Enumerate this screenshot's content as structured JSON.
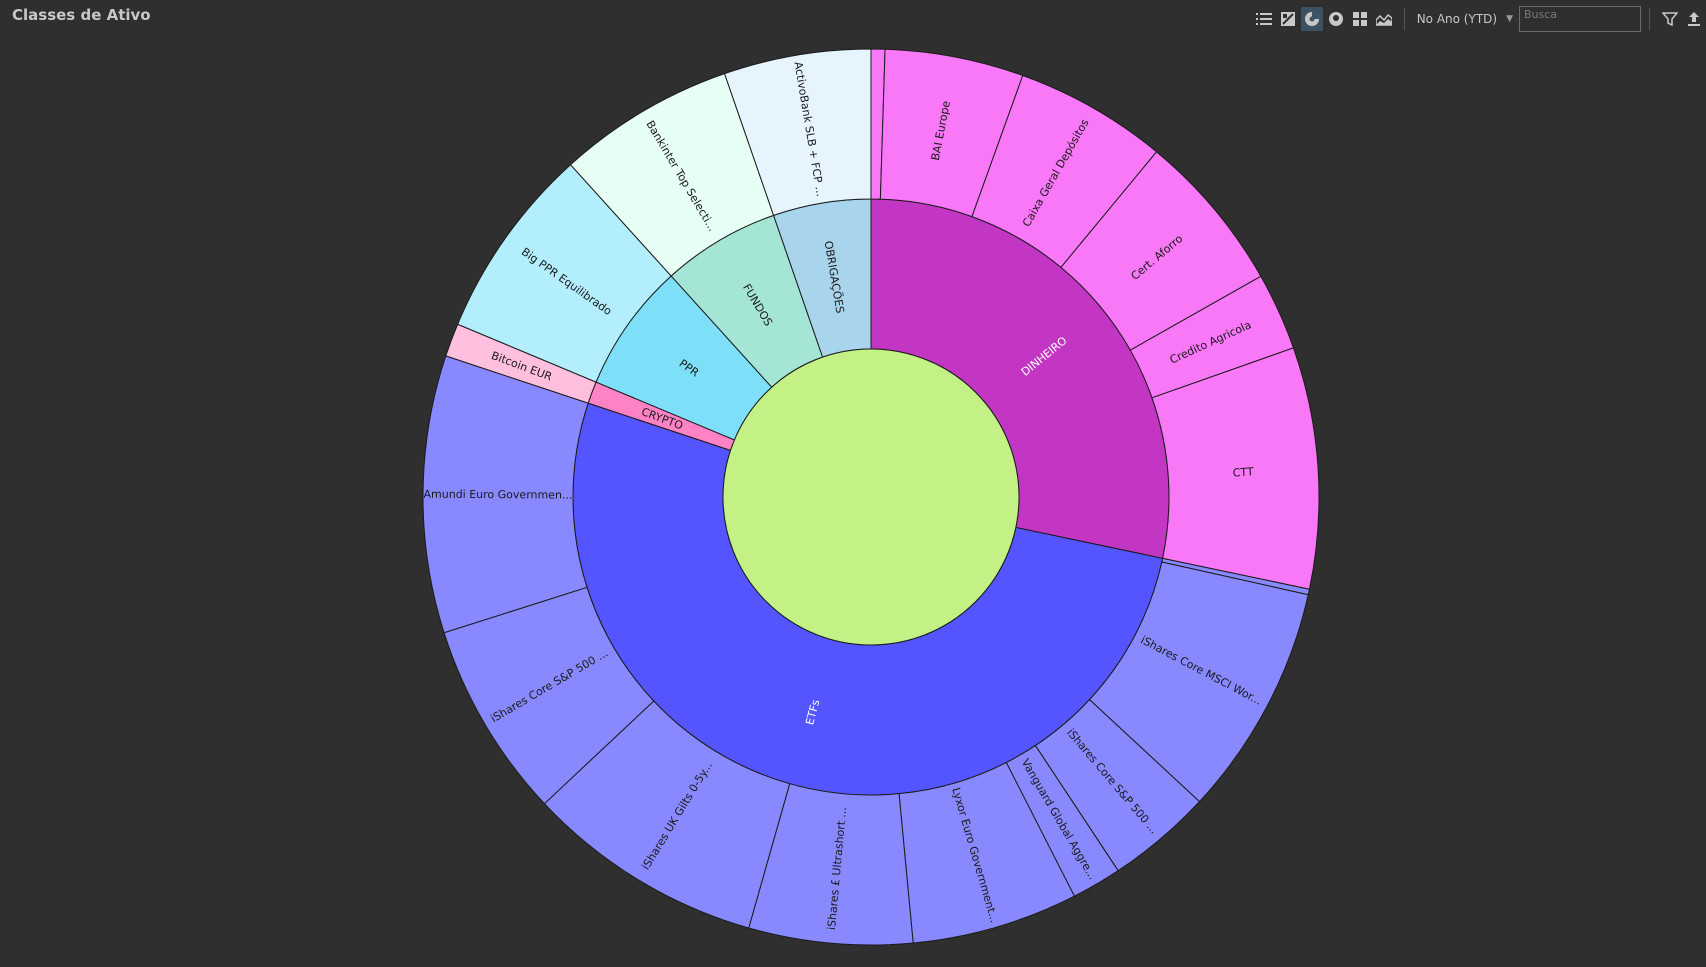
{
  "header": {
    "title": "Classes de Ativo"
  },
  "toolbar": {
    "icons": [
      "list-view-icon",
      "treemap-view-icon",
      "sunburst-view-icon",
      "donut-view-icon",
      "grid-view-icon",
      "area-chart-icon",
      "filter-icon",
      "export-icon"
    ],
    "period_label": "No Ano (YTD)",
    "search_placeholder": "Busca"
  },
  "chart_data": {
    "type": "sunburst",
    "title": "",
    "center_color": "#c3f185",
    "categories": [
      {
        "name": "DINHEIRO",
        "value": 28.3,
        "color": "#c335c3",
        "label_light": true,
        "children": [
          {
            "name": "",
            "value": 0.5,
            "color": "#f878f8"
          },
          {
            "name": "BAI Europe",
            "value": 5.0,
            "color": "#f878f8"
          },
          {
            "name": "Caixa Geral Depósitos",
            "value": 5.5,
            "color": "#f878f8"
          },
          {
            "name": "Cert. Aforro",
            "value": 5.8,
            "color": "#f878f8"
          },
          {
            "name": "Credito Agricola",
            "value": 2.8,
            "color": "#f878f8"
          },
          {
            "name": "CTT",
            "value": 8.7,
            "color": "#f878f8"
          }
        ]
      },
      {
        "name": "ETFs",
        "value": 51.8,
        "color": "#5555ff",
        "label_light": true,
        "children": [
          {
            "name": "",
            "value": 0.2,
            "color": "#8888ff"
          },
          {
            "name": "iShares Core MSCI Wor...",
            "value": 8.4,
            "color": "#8888ff"
          },
          {
            "name": "iShares Core S&P 500 ...",
            "value": 3.8,
            "color": "#8888ff"
          },
          {
            "name": "Vanguard Global Aggre...",
            "value": 1.8,
            "color": "#8888ff"
          },
          {
            "name": "Lyxor Euro Government...",
            "value": 6.0,
            "color": "#8888ff"
          },
          {
            "name": "iShares £ Ultrashort ...",
            "value": 5.9,
            "color": "#8888ff"
          },
          {
            "name": "iShares UK Gilts 0-5y...",
            "value": 8.6,
            "color": "#8888ff"
          },
          {
            "name": "iShares Core S&P 500 ...",
            "value": 7.1,
            "color": "#8888ff"
          },
          {
            "name": "Amundi Euro Governmen...",
            "value": 10.0,
            "color": "#8888ff"
          }
        ]
      },
      {
        "name": "CRYPTO",
        "value": 1.2,
        "color": "#ff82c4",
        "label_light": false,
        "children": [
          {
            "name": "Bitcoin EUR",
            "value": 1.2,
            "color": "#ffc0e0"
          }
        ]
      },
      {
        "name": "PPR",
        "value": 7.0,
        "color": "#7ddff8",
        "label_light": false,
        "children": [
          {
            "name": "Big PPR Equilibrado",
            "value": 7.0,
            "color": "#b3eefc"
          }
        ]
      },
      {
        "name": "FUNDOS",
        "value": 6.4,
        "color": "#a5e5d5",
        "label_light": false,
        "children": [
          {
            "name": "Bankinter Top Selecti...",
            "value": 6.4,
            "color": "#e6fef4"
          }
        ]
      },
      {
        "name": "OBRIGAÇÕES",
        "value": 5.3,
        "color": "#a8d4ec",
        "label_light": false,
        "children": [
          {
            "name": "ActivoBank SLB + FCP ...",
            "value": 5.3,
            "color": "#e6f4fe"
          }
        ]
      }
    ]
  }
}
